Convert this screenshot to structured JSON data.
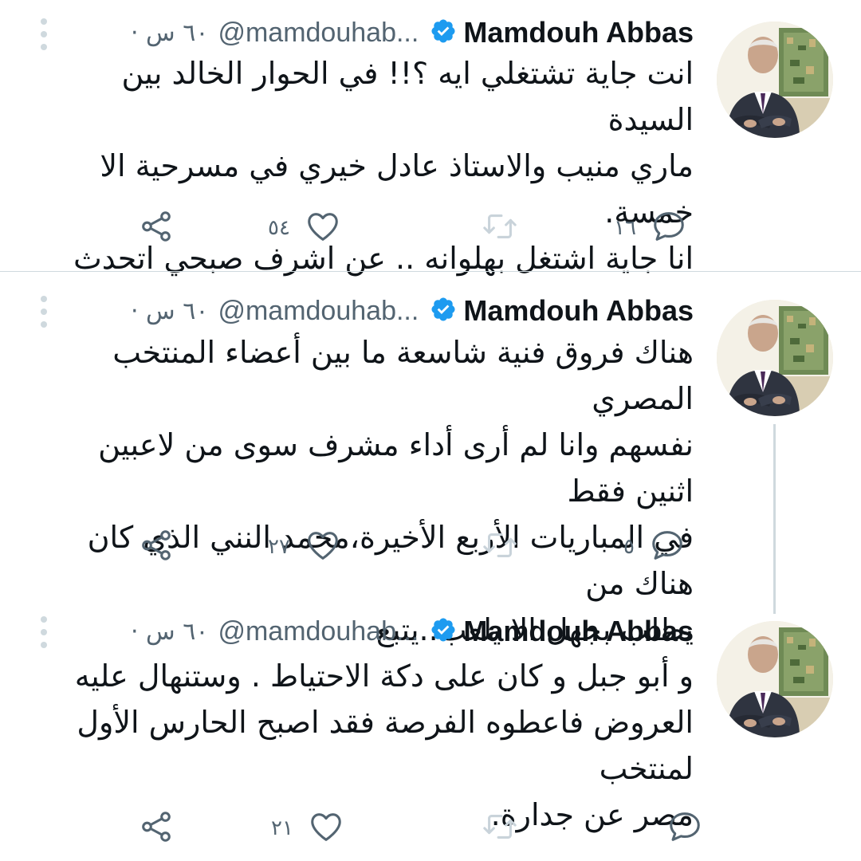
{
  "author": {
    "name": "Mamdouh Abbas",
    "handle": "@mamdouhab...",
    "verified": true,
    "accent_color": "#1d9bf0"
  },
  "tweets": [
    {
      "time": "٦٠ س",
      "separator": "·",
      "text": "انت جاية تشتغلي ايه ؟!! في الحوار الخالد بين السيدة\nماري منيب والاستاذ عادل خيري في مسرحية الا خمسة.\nانا جاية اشتغل بهلوانه .. عن اشرف صبحي اتحدث",
      "replies": "١٦",
      "retweets": "",
      "likes": "٥٤"
    },
    {
      "time": "٦٠ س",
      "separator": "·",
      "text": "هناك فروق فنية شاسعة ما بين أعضاء المنتخب المصري\nنفسهم وانا لم أرى أداء مشرف سوى من لاعبين اثنين فقط\nفي المباريات الأربع الأخيرة،محمد النني الذي كان هناك من\nيطلب بجهل الا يلعب..يتبع",
      "replies": "٥",
      "retweets": "",
      "likes": "٢٧"
    },
    {
      "time": "٦٠ س",
      "separator": "·",
      "text": "و أبو جبل و كان على دكة الاحتياط . وستنهال عليه\nالعروض فاعطوه الفرصة فقد اصبح الحارس الأول لمنتخب\nمصر عن جدارة.",
      "replies": "",
      "retweets": "",
      "likes": "٢١"
    }
  ],
  "icons": {
    "reply": "reply-icon",
    "retweet": "retweet-icon",
    "like": "heart-icon",
    "share": "share-icon",
    "more": "more-icon"
  }
}
